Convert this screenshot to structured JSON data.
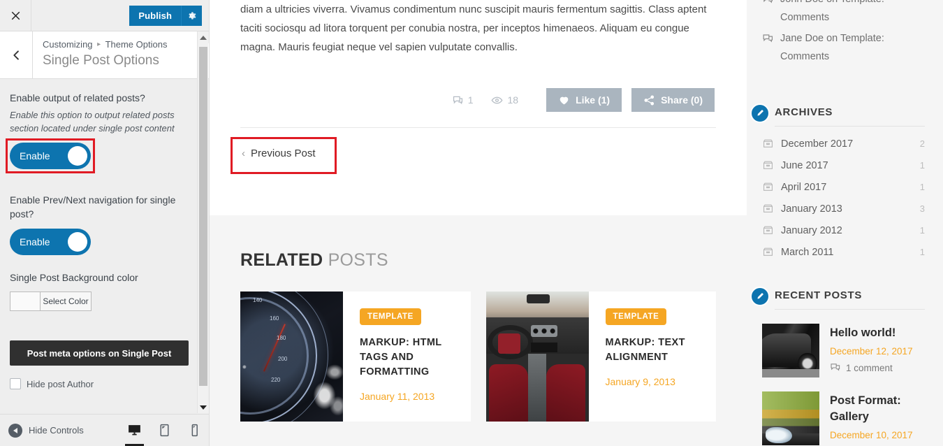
{
  "customizer": {
    "close_icon": "close-icon",
    "publish_label": "Publish",
    "gear_icon": "gear-icon",
    "back_icon": "chevron-left-icon",
    "breadcrumb_root": "Customizing",
    "breadcrumb_sep": "▸",
    "breadcrumb_section": "Theme Options",
    "panel_title": "Single Post Options",
    "accent_blue": "#0d74af",
    "highlight_red": "#e01b24",
    "controls": [
      {
        "label": "Enable output of related posts?",
        "description": "Enable this option to output related posts section located under single post content",
        "toggle_label": "Enable",
        "state": "on",
        "highlighted": true
      },
      {
        "label": "Enable Prev/Next navigation for single post?",
        "toggle_label": "Enable",
        "state": "on",
        "highlighted": false
      }
    ],
    "color_control": {
      "label": "Single Post Background color",
      "button_label": "Select Color",
      "swatch": "#fafafa"
    },
    "section_button": "Post meta options on Single Post",
    "checkbox": {
      "label": "Hide post Author",
      "checked": false
    },
    "footer": {
      "hide_controls_label": "Hide Controls",
      "devices": [
        {
          "name": "desktop",
          "active": true
        },
        {
          "name": "tablet",
          "active": false
        },
        {
          "name": "mobile",
          "active": false
        }
      ]
    }
  },
  "preview": {
    "post_paragraph": "diam a ultricies viverra. Vivamus condimentum nunc suscipit mauris fermentum sagittis. Class aptent taciti sociosqu ad litora torquent per conubia nostra, per inceptos himenaeos. Aliquam eu congue magna. Mauris feugiat neque vel sapien vulputate convallis.",
    "meta": {
      "comment_count": "1",
      "view_count": "18",
      "like_label": "Like (1)",
      "share_label": "Share (0)"
    },
    "prev_post_label": "Previous Post",
    "prev_post_chevron": "‹",
    "related": {
      "heading_bold": "RELATED",
      "heading_light": "POSTS",
      "posts": [
        {
          "badge": "TEMPLATE",
          "title": "MARKUP: HTML TAGS AND FORMATTING",
          "date": "January 11, 2013",
          "thumb": "speedometer-image"
        },
        {
          "badge": "TEMPLATE",
          "title": "MARKUP: TEXT ALIGNMENT",
          "date": "January 9, 2013",
          "thumb": "car-interior-image"
        }
      ]
    }
  },
  "widgets": {
    "recent_comments": [
      "John Doe on Template: Comments",
      "Jane Doe on Template: Comments"
    ],
    "archives": {
      "title": "ARCHIVES",
      "items": [
        {
          "label": "December 2017",
          "count": "2"
        },
        {
          "label": "June 2017",
          "count": "1"
        },
        {
          "label": "April 2017",
          "count": "1"
        },
        {
          "label": "January 2013",
          "count": "3"
        },
        {
          "label": "January 2012",
          "count": "1"
        },
        {
          "label": "March 2011",
          "count": "1"
        }
      ]
    },
    "recent_posts": {
      "title": "RECENT POSTS",
      "items": [
        {
          "title": "Hello world!",
          "date": "December 12, 2017",
          "comments": "1 comment",
          "thumb": "car-photo"
        },
        {
          "title": "Post Format: Gallery",
          "date": "December 10, 2017",
          "comments": "",
          "thumb": "gallery-photo"
        }
      ]
    }
  }
}
